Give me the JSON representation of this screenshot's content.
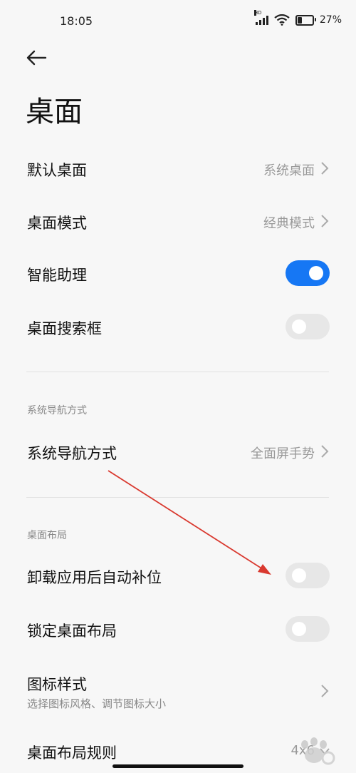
{
  "status_bar": {
    "time": "18:05",
    "network": "HD",
    "battery_text": "27%",
    "battery_level": 0.27
  },
  "page": {
    "title": "桌面"
  },
  "settings": {
    "default_launcher": {
      "label": "默认桌面",
      "value": "系统桌面"
    },
    "launcher_mode": {
      "label": "桌面模式",
      "value": "经典模式"
    },
    "smart_assistant": {
      "label": "智能助理",
      "enabled": true
    },
    "search_bar": {
      "label": "桌面搜索框",
      "enabled": false
    }
  },
  "navigation_section": {
    "header": "系统导航方式",
    "item": {
      "label": "系统导航方式",
      "value": "全面屏手势"
    }
  },
  "layout_section": {
    "header": "桌面布局",
    "auto_fill": {
      "label": "卸载应用后自动补位",
      "enabled": false
    },
    "lock_layout": {
      "label": "锁定桌面布局",
      "enabled": false
    },
    "icon_style": {
      "label": "图标样式",
      "subtitle": "选择图标风格、调节图标大小"
    },
    "layout_rule": {
      "label": "桌面布局规则",
      "value": "4x6"
    }
  },
  "colors": {
    "accent": "#1677f4",
    "annotation_arrow": "#d9392f"
  }
}
